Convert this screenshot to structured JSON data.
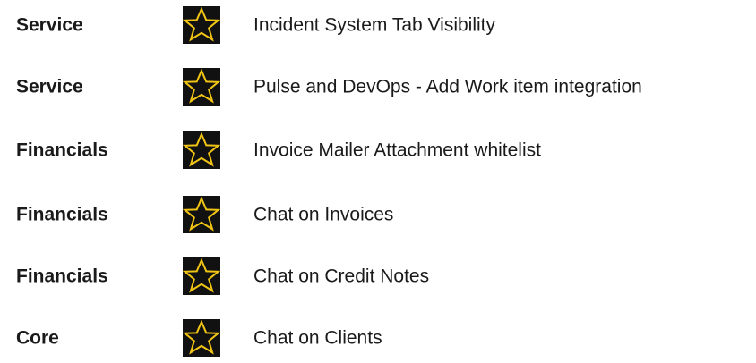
{
  "items": [
    {
      "category": "Service",
      "title": "Incident System Tab Visibility",
      "icon": "star-icon"
    },
    {
      "category": "Service",
      "title": "Pulse and DevOps - Add Work item integration",
      "icon": "star-icon"
    },
    {
      "category": "Financials",
      "title": "Invoice Mailer Attachment whitelist",
      "icon": "star-icon"
    },
    {
      "category": "Financials",
      "title": "Chat on Invoices",
      "icon": "star-icon"
    },
    {
      "category": "Financials",
      "title": "Chat on Credit Notes",
      "icon": "star-icon"
    },
    {
      "category": "Core",
      "title": "Chat on Clients",
      "icon": "star-icon"
    }
  ],
  "colors": {
    "icon_background": "#111111",
    "icon_star_outline": "#f2c514"
  }
}
